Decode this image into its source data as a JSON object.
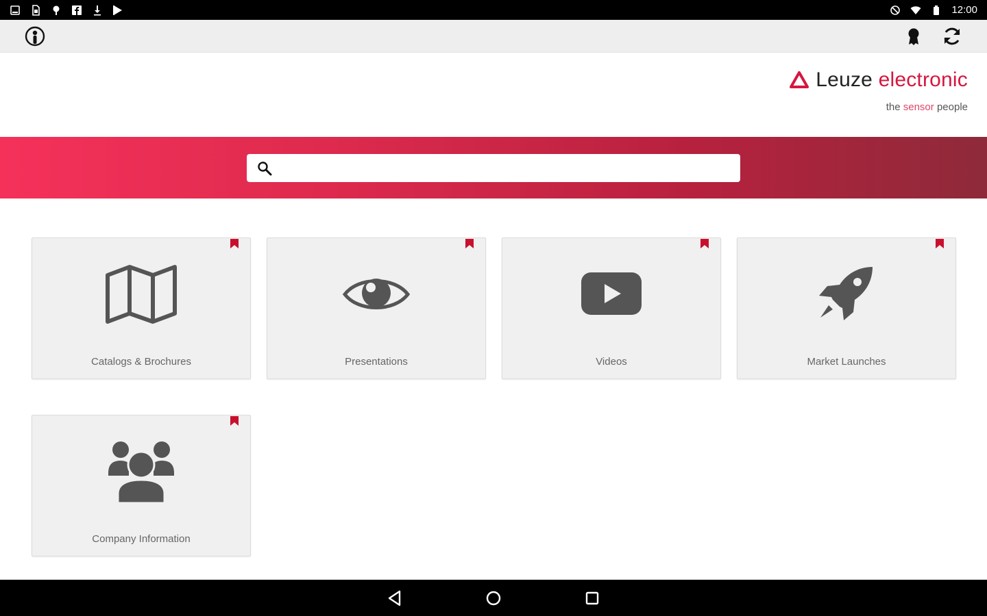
{
  "status_bar": {
    "time": "12:00",
    "left_icons": [
      "tablet-icon",
      "sim-icon",
      "pin-icon",
      "facebook-icon",
      "download-icon",
      "play-store-icon"
    ],
    "right_icons": [
      "alarm-icon",
      "wifi-icon",
      "battery-icon"
    ]
  },
  "toolbar": {
    "left_icon": "user-info-icon",
    "right_icons": [
      "award-badge-icon",
      "sync-icon"
    ]
  },
  "brand": {
    "name_primary": "Leuze",
    "name_accent": "electronic",
    "tagline_pre": "the",
    "tagline_accent": "sensor",
    "tagline_post": "people",
    "accent_color": "#d5173f"
  },
  "search": {
    "placeholder": "",
    "value": ""
  },
  "tiles": [
    {
      "label": "Catalogs & Brochures",
      "icon": "map-icon"
    },
    {
      "label": "Presentations",
      "icon": "eye-icon"
    },
    {
      "label": "Videos",
      "icon": "video-play-icon"
    },
    {
      "label": "Market Launches",
      "icon": "rocket-icon"
    },
    {
      "label": "Company Information",
      "icon": "group-icon"
    }
  ],
  "colors": {
    "banner_start": "#f5315a",
    "banner_end": "#8e2a3a",
    "bookmark": "#c8102e",
    "tile_bg": "#f0f0f0",
    "icon_gray": "#555555"
  },
  "nav_bar": {
    "buttons": [
      "back-icon",
      "home-icon",
      "recent-apps-icon"
    ]
  }
}
